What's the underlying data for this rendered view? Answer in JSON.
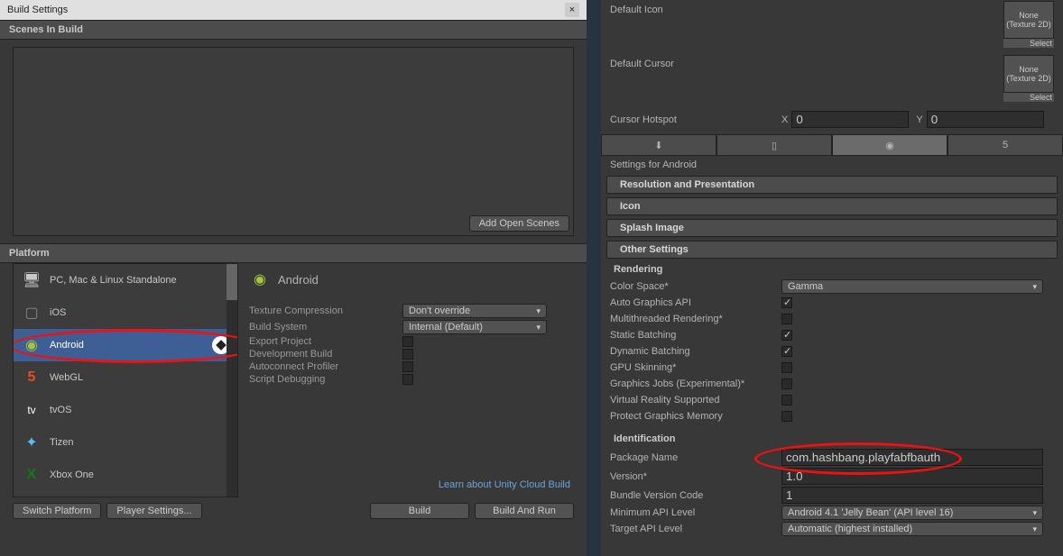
{
  "window": {
    "title": "Build Settings"
  },
  "sections": {
    "scenes": "Scenes In Build",
    "platform": "Platform",
    "addOpenScenes": "Add Open Scenes"
  },
  "platforms": [
    {
      "label": "PC, Mac & Linux Standalone",
      "icon": "🖥"
    },
    {
      "label": "iOS",
      "icon": "📱"
    },
    {
      "label": "Android",
      "icon": "🤖"
    },
    {
      "label": "WebGL",
      "icon": "5"
    },
    {
      "label": "tvOS",
      "icon": "tv"
    },
    {
      "label": "Tizen",
      "icon": "✦"
    },
    {
      "label": "Xbox One",
      "icon": "X"
    }
  ],
  "details": {
    "heading": "Android",
    "textureCompression": {
      "label": "Texture Compression",
      "value": "Don't override"
    },
    "buildSystem": {
      "label": "Build System",
      "value": "Internal (Default)"
    },
    "exportProject": "Export Project",
    "devBuild": "Development Build",
    "autoProfiler": "Autoconnect Profiler",
    "scriptDebug": "Script Debugging",
    "cloudLink": "Learn about Unity Cloud Build"
  },
  "buttons": {
    "switch": "Switch Platform",
    "playerSettings": "Player Settings...",
    "build": "Build",
    "buildRun": "Build And Run"
  },
  "inspector": {
    "defaultIcon": "Default Icon",
    "defaultCursor": "Default Cursor",
    "cursorHotspot": "Cursor Hotspot",
    "thumbNone": "None",
    "thumbTex": "(Texture 2D)",
    "select": "Select",
    "x": "X",
    "y": "Y",
    "xval": "0",
    "yval": "0",
    "settingsFor": "Settings for Android",
    "resPres": "Resolution and Presentation",
    "icon": "Icon",
    "splash": "Splash Image",
    "other": "Other Settings",
    "rendering": "Rendering",
    "colorSpace": {
      "label": "Color Space*",
      "value": "Gamma"
    },
    "autoGraphics": "Auto Graphics API",
    "multiRend": "Multithreaded Rendering*",
    "staticBatch": "Static Batching",
    "dynBatch": "Dynamic Batching",
    "gpuSkin": "GPU Skinning*",
    "graphicsJobs": "Graphics Jobs (Experimental)*",
    "vrSupport": "Virtual Reality Supported",
    "protectMem": "Protect Graphics Memory",
    "identification": "Identification",
    "packageName": {
      "label": "Package Name",
      "value": "com.hashbang.playfabfbauth"
    },
    "version": {
      "label": "Version*",
      "value": "1.0"
    },
    "bundleCode": {
      "label": "Bundle Version Code",
      "value": "1"
    },
    "minApi": {
      "label": "Minimum API Level",
      "value": "Android 4.1 'Jelly Bean' (API level 16)"
    },
    "targetApi": {
      "label": "Target API Level",
      "value": "Automatic (highest installed)"
    }
  }
}
